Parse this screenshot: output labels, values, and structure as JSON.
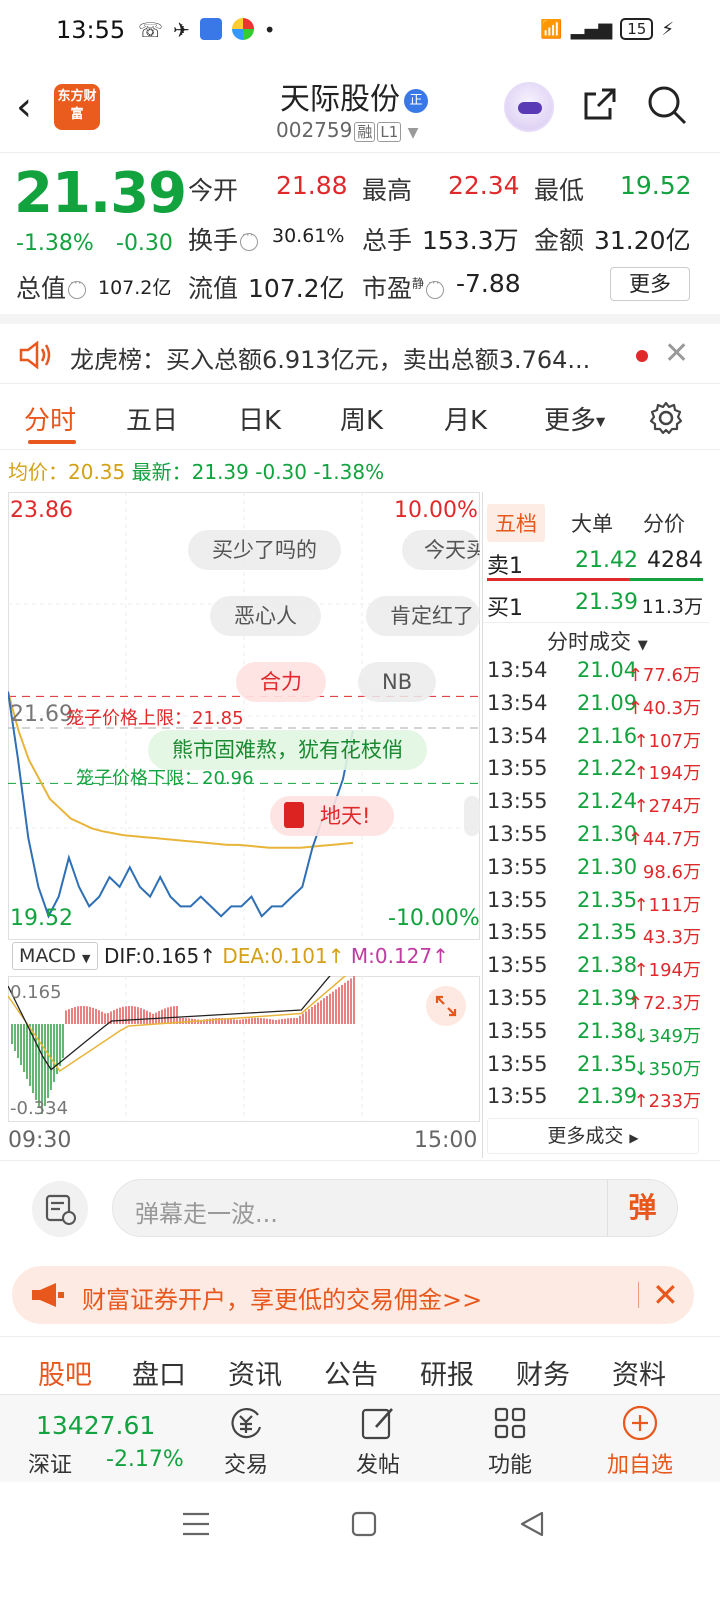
{
  "status_bar": {
    "time": "13:55",
    "battery": "15"
  },
  "header": {
    "logo_text": "东方财富",
    "title": "天际股份",
    "title_badge": "正",
    "code": "002759",
    "code_tags": [
      "融",
      "L1"
    ]
  },
  "quote": {
    "price": "21.39",
    "change_pct": "-1.38%",
    "change": "-0.30",
    "items": [
      {
        "label": "今开",
        "value": "21.88",
        "color": "red"
      },
      {
        "label": "最高",
        "value": "22.34",
        "color": "red"
      },
      {
        "label": "最低",
        "value": "19.52",
        "color": "green"
      },
      {
        "label": "换手",
        "value": "30.61%",
        "color": "plain"
      },
      {
        "label": "总手",
        "value": "153.3万",
        "color": "plain"
      },
      {
        "label": "金额",
        "value": "31.20亿",
        "color": "plain"
      },
      {
        "label": "总值",
        "value": "107.2亿",
        "color": "plain"
      },
      {
        "label": "流值",
        "value": "107.2亿",
        "color": "plain"
      },
      {
        "label": "市盈",
        "value": "-7.88",
        "color": "plain",
        "superscript": "静"
      }
    ],
    "more_label": "更多"
  },
  "notice": {
    "text": "龙虎榜：买入总额6.913亿元，卖出总额3.764..."
  },
  "tabs": {
    "items": [
      "分时",
      "五日",
      "日K",
      "周K",
      "月K",
      "更多"
    ],
    "active": "分时"
  },
  "avg_line": {
    "avg_label": "均价：",
    "avg_value": "20.35",
    "latest_label": "最新：",
    "latest_value": "21.39",
    "latest_change": "-0.30",
    "latest_pct": "-1.38%"
  },
  "chart": {
    "top_price": "23.86",
    "top_pct": "10.00%",
    "bottom_price": "19.52",
    "bottom_pct": "-10.00%",
    "ref_price": "21.69",
    "upper_limit_label": "笼子价格上限：21.85",
    "lower_limit_label": "笼子价格下限：20.96",
    "danmu": [
      "买少了吗的",
      "今天买",
      "恶心人",
      "肯定红了",
      "合力",
      "NB",
      "熊市固难熬，犹有花枝俏",
      "地天!"
    ]
  },
  "chart_data": {
    "type": "line",
    "title": "",
    "xlabel": "",
    "ylabel": "",
    "x_range": [
      "09:30",
      "15:00"
    ],
    "ylim": [
      19.52,
      23.86
    ],
    "series": [
      {
        "name": "",
        "values": [
          21.9,
          21.2,
          20.4,
          19.9,
          19.6,
          19.8,
          20.2,
          19.9,
          19.7,
          19.8,
          20.0,
          19.9,
          20.1,
          19.9,
          19.8,
          20.0,
          19.8,
          19.7,
          19.7,
          19.8,
          19.7,
          19.6,
          19.7,
          19.7,
          19.8,
          19.6,
          19.7,
          19.7,
          19.8,
          19.9,
          20.3,
          20.6,
          20.7,
          21.0,
          21.5
        ]
      },
      {
        "name": "",
        "values": [
          21.9,
          21.5,
          21.2,
          21.0,
          20.8,
          20.7,
          20.6,
          20.55,
          20.5,
          20.47,
          20.45,
          20.43,
          20.42,
          20.41,
          20.4,
          20.39,
          20.38,
          20.37,
          20.36,
          20.35,
          20.34,
          20.33,
          20.33,
          20.32,
          20.31,
          20.3,
          20.3,
          20.3,
          20.3,
          20.31,
          20.32,
          20.33,
          20.34,
          20.35
        ]
      }
    ]
  },
  "macd": {
    "selector": "MACD",
    "dif": "DIF:0.165",
    "dea": "DEA:0.101",
    "m": "M:0.127",
    "top_label": "0.165",
    "bottom_label": "-0.334"
  },
  "time_axis": {
    "start": "09:30",
    "end": "15:00"
  },
  "order_book": {
    "tabs": [
      "五档",
      "大单",
      "分价"
    ],
    "sell1": {
      "label": "卖1",
      "price": "21.42",
      "vol": "4284"
    },
    "buy1": {
      "label": "买1",
      "price": "21.39",
      "vol": "11.3万"
    },
    "trades_title": "分时成交",
    "trades": [
      {
        "time": "13:54",
        "price": "21.04",
        "dir": "↑",
        "vol": "77.6万"
      },
      {
        "time": "13:54",
        "price": "21.09",
        "dir": "↑",
        "vol": "40.3万"
      },
      {
        "time": "13:54",
        "price": "21.16",
        "dir": "↑",
        "vol": "107万"
      },
      {
        "time": "13:55",
        "price": "21.22",
        "dir": "↑",
        "vol": "194万"
      },
      {
        "time": "13:55",
        "price": "21.24",
        "dir": "↑",
        "vol": "274万"
      },
      {
        "time": "13:55",
        "price": "21.30",
        "dir": "↑",
        "vol": "44.7万"
      },
      {
        "time": "13:55",
        "price": "21.30",
        "dir": "",
        "vol": "98.6万"
      },
      {
        "time": "13:55",
        "price": "21.35",
        "dir": "↑",
        "vol": "111万"
      },
      {
        "time": "13:55",
        "price": "21.35",
        "dir": "",
        "vol": "43.3万"
      },
      {
        "time": "13:55",
        "price": "21.38",
        "dir": "↑",
        "vol": "194万"
      },
      {
        "time": "13:55",
        "price": "21.39",
        "dir": "↑",
        "vol": "72.3万"
      },
      {
        "time": "13:55",
        "price": "21.38",
        "dir": "↓",
        "vol": "349万"
      },
      {
        "time": "13:55",
        "price": "21.35",
        "dir": "↓",
        "vol": "350万"
      },
      {
        "time": "13:55",
        "price": "21.39",
        "dir": "↑",
        "vol": "233万"
      }
    ],
    "more_trades": "更多成交"
  },
  "danmu_bar": {
    "placeholder": "弹幕走一波...",
    "send": "弹"
  },
  "promo": {
    "text": "财富证券开户，享更低的交易佣金>>"
  },
  "info_tabs": {
    "items": [
      "股吧",
      "盘口",
      "资讯",
      "公告",
      "研报",
      "财务",
      "资料"
    ],
    "active": "股吧"
  },
  "bottom_nav": {
    "index_value": "13427.61",
    "index_name": "深证",
    "index_change": "-2.17%",
    "items": [
      "交易",
      "发帖",
      "功能",
      "加自选"
    ]
  }
}
